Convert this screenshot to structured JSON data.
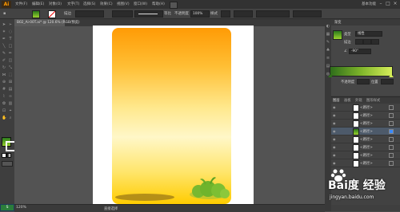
{
  "app": {
    "logo": "Ai",
    "workspace": "基本功能"
  },
  "menu": [
    "文件(F)",
    "编辑(E)",
    "对象(O)",
    "文字(T)",
    "选择(S)",
    "效果(C)",
    "视图(V)",
    "窗口(W)",
    "帮助(H)"
  ],
  "controlbar": {
    "stroke_label": "描边",
    "style_label": "等比",
    "opacity_label": "不透明度",
    "opacity_value": "100%",
    "style2_label": "样式"
  },
  "document": {
    "tab_title": "B02_Ai-00T.ai* @ 120.6% (RGB/预览)"
  },
  "statusbar": {
    "zoom": "120%",
    "label": "直接选择"
  },
  "taskbar": {
    "start": "S"
  },
  "gradient_panel": {
    "tab": "渐变",
    "type_label": "类型",
    "type_value": "线性",
    "stroke_label": "描边",
    "angle_value": "-90°",
    "opacity_label": "不透明度",
    "location_label": "位置",
    "colors": {
      "start": "#2f6e1b",
      "mid": "#7fb52a",
      "end": "#d6ee5a"
    }
  },
  "layers_panel": {
    "tabs": [
      "图层",
      "画板",
      "外观",
      "图形样式"
    ],
    "rows": [
      "<路径>",
      "<路径>",
      "<路径>",
      "<路径>",
      "<路径>",
      "<路径>",
      "<路径>",
      "<路径>",
      "<路径>",
      "<路径>"
    ]
  },
  "canvas": {
    "art_colors": {
      "top": "#ff9b05",
      "mid": "#fff7c8",
      "bottom": "#ffcc00",
      "bush": "#6fb42c",
      "shadow": "#a88417"
    }
  },
  "watermark": {
    "text": "Bai度 经验",
    "url": "jingyan.baidu.com"
  }
}
